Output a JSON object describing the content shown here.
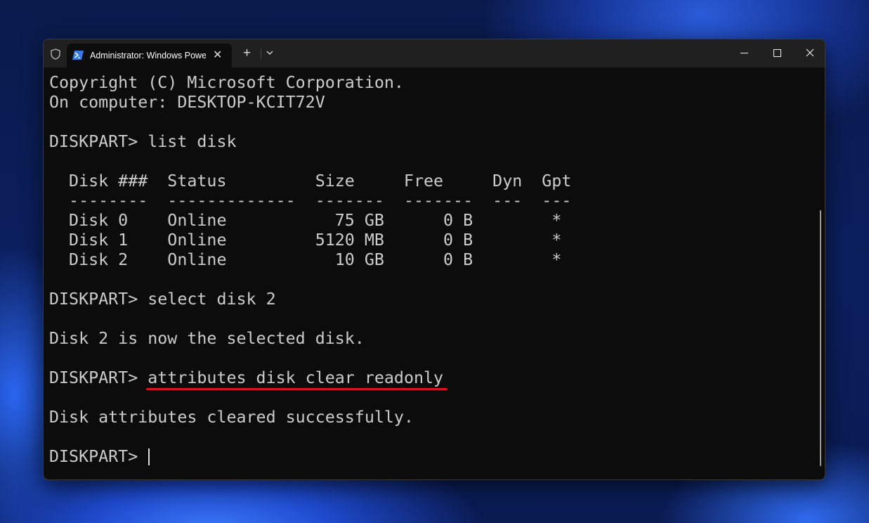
{
  "titlebar": {
    "tab_title": "Administrator: Windows PowerShell",
    "new_tab": "+",
    "dropdown": "⌄",
    "close_tab": "✕",
    "close": "✕"
  },
  "terminal": {
    "lines": [
      "Copyright (C) Microsoft Corporation.",
      "On computer: DESKTOP-KCIT72V",
      "",
      "DISKPART> list disk",
      "",
      "  Disk ###  Status         Size     Free     Dyn  Gpt",
      "  --------  -------------  -------  -------  ---  ---",
      "  Disk 0    Online           75 GB      0 B        *",
      "  Disk 1    Online         5120 MB      0 B        *",
      "  Disk 2    Online           10 GB      0 B        *",
      "",
      "DISKPART> select disk 2",
      "",
      "Disk 2 is now the selected disk.",
      ""
    ],
    "highlight_prompt": "DISKPART> ",
    "highlight_command": "attributes disk clear readonly",
    "after_lines": [
      "",
      "Disk attributes cleared successfully.",
      ""
    ],
    "current_prompt": "DISKPART> "
  },
  "colors": {
    "underline": "#d8141e",
    "text": "#cccccc",
    "background": "#0c0c0c"
  }
}
